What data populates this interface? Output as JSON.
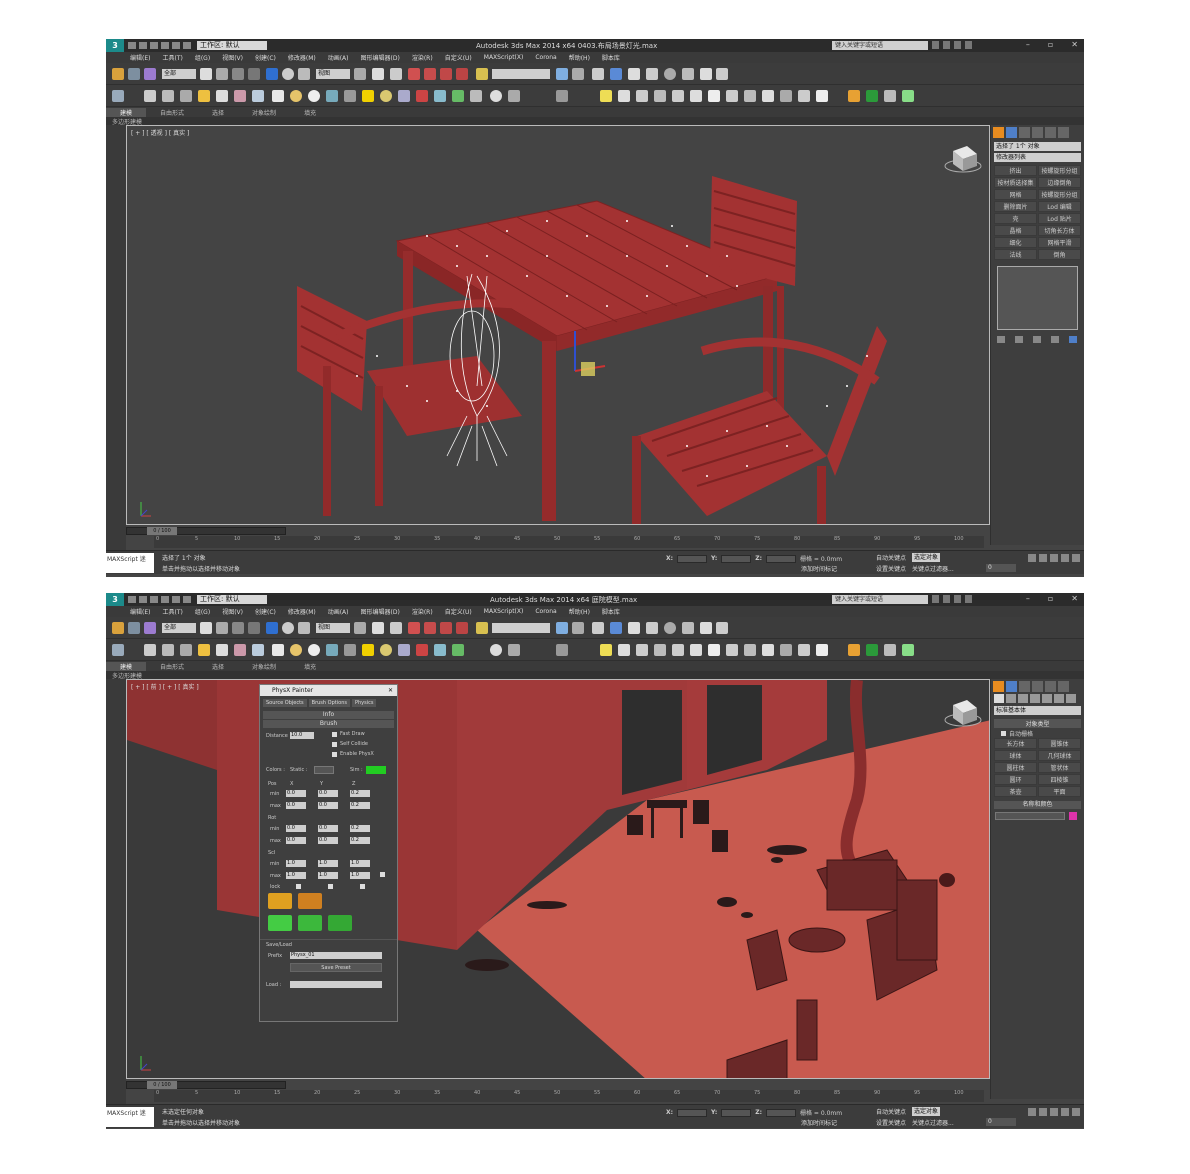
{
  "common": {
    "logo": "3",
    "workspace": "工作区: 默认",
    "menu": [
      "编辑(E)",
      "工具(T)",
      "组(G)",
      "视图(V)",
      "创建(C)",
      "修改器(M)",
      "动画(A)",
      "图形编辑器(D)",
      "渲染(R)",
      "自定义(U)",
      "MAXScript(X)",
      "Corona",
      "帮助(H)",
      "脚本库"
    ],
    "ribbon_tabs": [
      "建模",
      "自由形式",
      "选择",
      "对象绘制",
      "填充"
    ],
    "ribbon_sub": "多边形建模",
    "viewport_dropdown": "视图",
    "toolbar_dropdown": "全部",
    "ruler_ticks": [
      "0",
      "5",
      "10",
      "15",
      "20",
      "25",
      "30",
      "35",
      "40",
      "45",
      "50",
      "55",
      "60",
      "65",
      "70",
      "75",
      "80",
      "85",
      "90",
      "95",
      "100"
    ],
    "time_pos": "0 / 100",
    "maxscript_label": "MAXScript 迷",
    "status_prompt": "单击并拖动以选择并移动对象",
    "grid_label": "栅格 = 0.0mm",
    "auto_key": "自动关键点",
    "set_key": "设置关键点",
    "selected_obj": "选定对象",
    "key_filter": "关键点过滤器...",
    "add_time_tag": "添加时间标记",
    "frame_value": "0",
    "x_label": "X:",
    "y_label": "Y:",
    "z_label": "Z:"
  },
  "shot1": {
    "title": "Autodesk 3ds Max  2014 x64      0403.布局场景灯光.max",
    "search_placeholder": "键入关键字或短语",
    "viewport_label": "[ + ] [ 透视 ] [ 真实 ]",
    "status_line1": "选择了 1个 对象",
    "cmd_name": "选择了 1个 对象",
    "cmd_mod_list": "修改器列表",
    "cmd_buttons": [
      "挤出",
      "按螺旋形分组",
      "按材质选择集",
      "边缘倒角",
      "网格",
      "按螺旋形分组",
      "删除面片",
      "Lod 编辑",
      "壳",
      "Lod 贴片",
      "晶格",
      "切角长方体",
      "细化",
      "网格平滑",
      "法线",
      "倒角"
    ],
    "coord": "X:         Y:        Z:"
  },
  "shot2": {
    "title": "Autodesk 3ds Max  2014 x64      庭院模型.max",
    "search_placeholder": "键入关键字或短语",
    "viewport_label": "[ + ] [ 前 ] [ + ] [ 真实 ]",
    "status_line1": "未选定任何对象",
    "cmd_dropdown": "标准基本体",
    "cmd_section1": "对象类型",
    "cmd_autogrid": "自动栅格",
    "cmd_buttons": [
      "长方体",
      "圆锥体",
      "球体",
      "几何球体",
      "圆柱体",
      "管状体",
      "圆环",
      "四棱锥",
      "茶壶",
      "平面"
    ],
    "cmd_section2": "名称和颜色",
    "physx": {
      "title": "PhysX Painter",
      "tabs": [
        "Source Objects",
        "Brush Options",
        "Physics"
      ],
      "sec_info": "Info",
      "sec_brush": "Brush",
      "distance_label": "Distance",
      "distance_value": "10.0",
      "chk_fast": "Fast Draw",
      "chk_self": "Self Collide",
      "chk_enable": "Enable PhysX",
      "colors_label": "Colors :",
      "static_label": "Static :",
      "sim_label": "Sim :",
      "pos_label": "Pos",
      "rot_label": "Rot",
      "scl_label": "Scl",
      "x": "X",
      "y": "Y",
      "z": "Z",
      "min_label": "min",
      "max_label": "max",
      "lock_label": "lock",
      "pos_min": [
        "0.0",
        "0.0",
        "0.2"
      ],
      "pos_max": [
        "0.0",
        "0.0",
        "0.2"
      ],
      "rot_min": [
        "0.0",
        "0.0",
        "0.2"
      ],
      "rot_max": [
        "0.0",
        "0.0",
        "0.2"
      ],
      "scl_min": [
        "1.0",
        "1.0",
        "1.0"
      ],
      "scl_max": [
        "1.0",
        "1.0",
        "1.0"
      ],
      "saveload": "Save/Load",
      "prefix_label": "Prefix",
      "prefix_value": "Physx_01",
      "save_preset": "Save Preset",
      "load_label": "Load :"
    }
  },
  "colors": {
    "accent_green": "#22cc22",
    "accent_magenta": "#dd33aa",
    "scene_red": "#a43333",
    "viewport_bg": "#444444"
  }
}
